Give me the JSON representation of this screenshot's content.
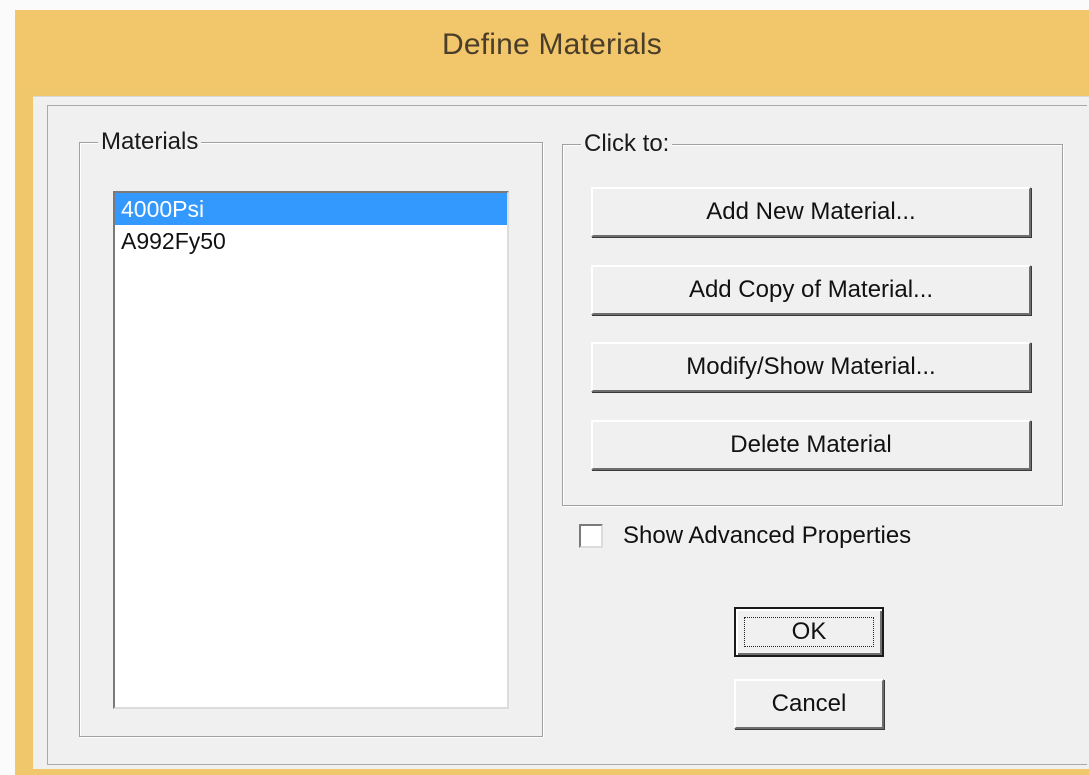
{
  "window": {
    "title": "Define Materials"
  },
  "materials": {
    "label": "Materials",
    "items": [
      "4000Psi",
      "A992Fy50"
    ],
    "selected": "4000Psi"
  },
  "click_to": {
    "label": "Click to:",
    "add_new": "Add New Material...",
    "add_copy": "Add Copy of Material...",
    "modify_show": "Modify/Show Material...",
    "delete": "Delete Material"
  },
  "advanced": {
    "label": "Show Advanced Properties",
    "checked": false
  },
  "buttons": {
    "ok": "OK",
    "cancel": "Cancel"
  },
  "colors": {
    "titlebar": "#f2c66a",
    "selection": "#3399ff",
    "dialog_bg": "#f0f0f0"
  }
}
